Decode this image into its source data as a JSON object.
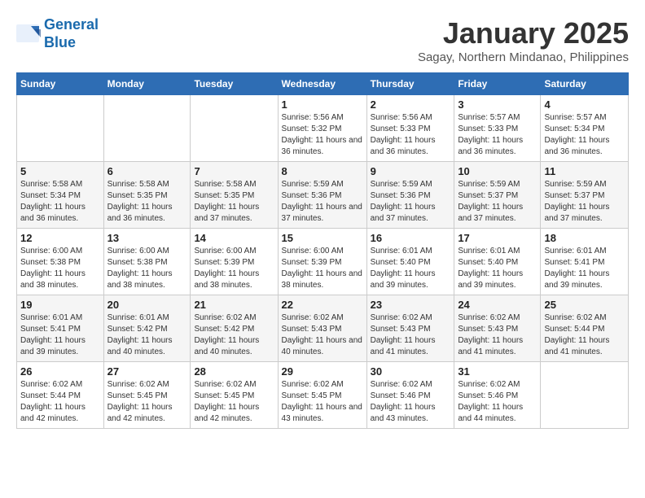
{
  "logo": {
    "line1": "General",
    "line2": "Blue"
  },
  "header": {
    "month_year": "January 2025",
    "location": "Sagay, Northern Mindanao, Philippines"
  },
  "weekdays": [
    "Sunday",
    "Monday",
    "Tuesday",
    "Wednesday",
    "Thursday",
    "Friday",
    "Saturday"
  ],
  "weeks": [
    [
      {
        "day": "",
        "info": ""
      },
      {
        "day": "",
        "info": ""
      },
      {
        "day": "",
        "info": ""
      },
      {
        "day": "1",
        "info": "Sunrise: 5:56 AM\nSunset: 5:32 PM\nDaylight: 11 hours and 36 minutes."
      },
      {
        "day": "2",
        "info": "Sunrise: 5:56 AM\nSunset: 5:33 PM\nDaylight: 11 hours and 36 minutes."
      },
      {
        "day": "3",
        "info": "Sunrise: 5:57 AM\nSunset: 5:33 PM\nDaylight: 11 hours and 36 minutes."
      },
      {
        "day": "4",
        "info": "Sunrise: 5:57 AM\nSunset: 5:34 PM\nDaylight: 11 hours and 36 minutes."
      }
    ],
    [
      {
        "day": "5",
        "info": "Sunrise: 5:58 AM\nSunset: 5:34 PM\nDaylight: 11 hours and 36 minutes."
      },
      {
        "day": "6",
        "info": "Sunrise: 5:58 AM\nSunset: 5:35 PM\nDaylight: 11 hours and 36 minutes."
      },
      {
        "day": "7",
        "info": "Sunrise: 5:58 AM\nSunset: 5:35 PM\nDaylight: 11 hours and 37 minutes."
      },
      {
        "day": "8",
        "info": "Sunrise: 5:59 AM\nSunset: 5:36 PM\nDaylight: 11 hours and 37 minutes."
      },
      {
        "day": "9",
        "info": "Sunrise: 5:59 AM\nSunset: 5:36 PM\nDaylight: 11 hours and 37 minutes."
      },
      {
        "day": "10",
        "info": "Sunrise: 5:59 AM\nSunset: 5:37 PM\nDaylight: 11 hours and 37 minutes."
      },
      {
        "day": "11",
        "info": "Sunrise: 5:59 AM\nSunset: 5:37 PM\nDaylight: 11 hours and 37 minutes."
      }
    ],
    [
      {
        "day": "12",
        "info": "Sunrise: 6:00 AM\nSunset: 5:38 PM\nDaylight: 11 hours and 38 minutes."
      },
      {
        "day": "13",
        "info": "Sunrise: 6:00 AM\nSunset: 5:38 PM\nDaylight: 11 hours and 38 minutes."
      },
      {
        "day": "14",
        "info": "Sunrise: 6:00 AM\nSunset: 5:39 PM\nDaylight: 11 hours and 38 minutes."
      },
      {
        "day": "15",
        "info": "Sunrise: 6:00 AM\nSunset: 5:39 PM\nDaylight: 11 hours and 38 minutes."
      },
      {
        "day": "16",
        "info": "Sunrise: 6:01 AM\nSunset: 5:40 PM\nDaylight: 11 hours and 39 minutes."
      },
      {
        "day": "17",
        "info": "Sunrise: 6:01 AM\nSunset: 5:40 PM\nDaylight: 11 hours and 39 minutes."
      },
      {
        "day": "18",
        "info": "Sunrise: 6:01 AM\nSunset: 5:41 PM\nDaylight: 11 hours and 39 minutes."
      }
    ],
    [
      {
        "day": "19",
        "info": "Sunrise: 6:01 AM\nSunset: 5:41 PM\nDaylight: 11 hours and 39 minutes."
      },
      {
        "day": "20",
        "info": "Sunrise: 6:01 AM\nSunset: 5:42 PM\nDaylight: 11 hours and 40 minutes."
      },
      {
        "day": "21",
        "info": "Sunrise: 6:02 AM\nSunset: 5:42 PM\nDaylight: 11 hours and 40 minutes."
      },
      {
        "day": "22",
        "info": "Sunrise: 6:02 AM\nSunset: 5:43 PM\nDaylight: 11 hours and 40 minutes."
      },
      {
        "day": "23",
        "info": "Sunrise: 6:02 AM\nSunset: 5:43 PM\nDaylight: 11 hours and 41 minutes."
      },
      {
        "day": "24",
        "info": "Sunrise: 6:02 AM\nSunset: 5:43 PM\nDaylight: 11 hours and 41 minutes."
      },
      {
        "day": "25",
        "info": "Sunrise: 6:02 AM\nSunset: 5:44 PM\nDaylight: 11 hours and 41 minutes."
      }
    ],
    [
      {
        "day": "26",
        "info": "Sunrise: 6:02 AM\nSunset: 5:44 PM\nDaylight: 11 hours and 42 minutes."
      },
      {
        "day": "27",
        "info": "Sunrise: 6:02 AM\nSunset: 5:45 PM\nDaylight: 11 hours and 42 minutes."
      },
      {
        "day": "28",
        "info": "Sunrise: 6:02 AM\nSunset: 5:45 PM\nDaylight: 11 hours and 42 minutes."
      },
      {
        "day": "29",
        "info": "Sunrise: 6:02 AM\nSunset: 5:45 PM\nDaylight: 11 hours and 43 minutes."
      },
      {
        "day": "30",
        "info": "Sunrise: 6:02 AM\nSunset: 5:46 PM\nDaylight: 11 hours and 43 minutes."
      },
      {
        "day": "31",
        "info": "Sunrise: 6:02 AM\nSunset: 5:46 PM\nDaylight: 11 hours and 44 minutes."
      },
      {
        "day": "",
        "info": ""
      }
    ]
  ]
}
